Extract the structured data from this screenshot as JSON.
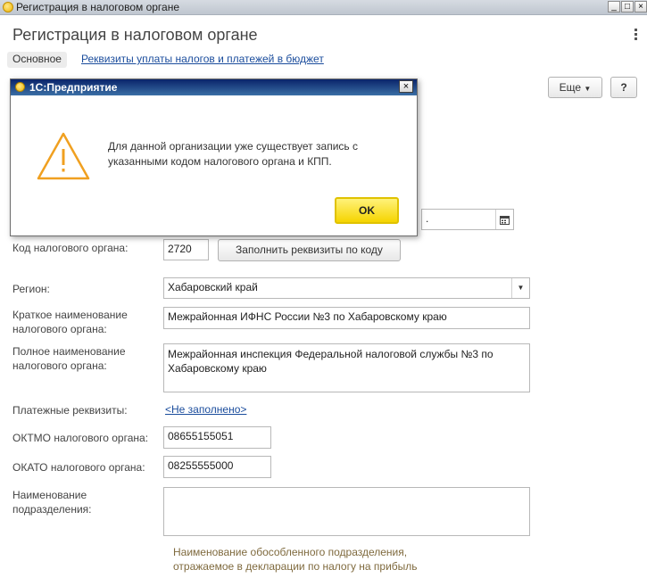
{
  "window": {
    "title": "Регистрация в налоговом органе",
    "minimize": "_",
    "maximize": "□",
    "close": "×"
  },
  "header": {
    "page_title": "Регистрация в налоговом органе"
  },
  "tabs": [
    {
      "label": "Основное",
      "active": true
    },
    {
      "label": "Реквизиты уплаты налогов и платежей в бюджет",
      "active": false
    }
  ],
  "toolbar": {
    "more_label": "Еще",
    "help_label": "?"
  },
  "form": {
    "date_fragment": ".",
    "tax_code_label": "Код налогового органа:",
    "tax_code_value": "2720",
    "fill_button": "Заполнить реквизиты по коду",
    "region_label": "Регион:",
    "region_value": "Хабаровский край",
    "short_name_label": "Краткое наименование налогового органа:",
    "short_name_value": "Межрайонная ИФНС России №3 по Хабаровскому краю",
    "full_name_label": "Полное наименование налогового органа:",
    "full_name_value": "Межрайонная инспекция Федеральной налоговой службы №3 по Хабаровскому краю",
    "payment_label": "Платежные реквизиты:",
    "payment_link": "<Не заполнено>",
    "oktmo_label": "ОКТМО налогового органа:",
    "oktmo_value": "08655155051",
    "okato_label": "ОКАТО налогового органа:",
    "okato_value": "08255555000",
    "division_label": "Наименование подразделения:",
    "division_value": "",
    "division_hint": "Наименование обособленного подразделения, отражаемое в декларации по налогу на прибыль"
  },
  "dialog": {
    "title": "1С:Предприятие",
    "close": "×",
    "message": "Для данной организации уже существует запись с указанными кодом налогового органа и КПП.",
    "ok_label": "OK",
    "icon": "warning-icon"
  },
  "colors": {
    "link": "#1a4c9c",
    "ok_button": "#f5d400",
    "warning": "#f0a020",
    "hint": "#7f6a3e"
  }
}
